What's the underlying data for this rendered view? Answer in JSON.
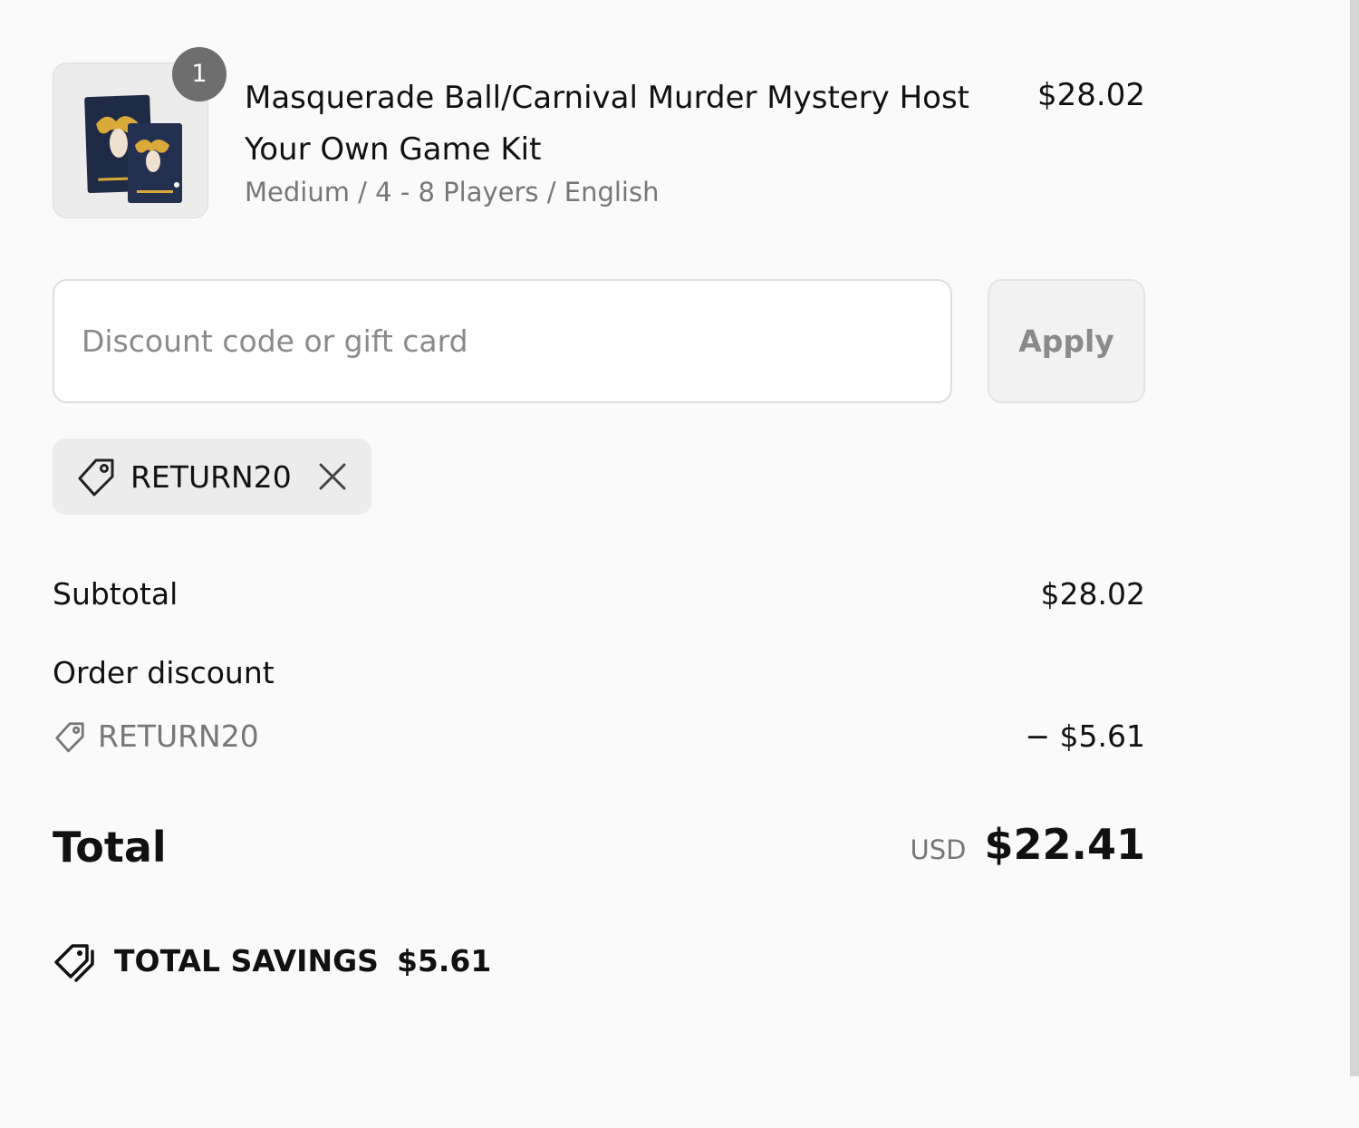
{
  "product": {
    "quantity": "1",
    "title": "Masquerade Ball/Carnival Murder Mystery Host Your Own Game Kit",
    "variant": "Medium / 4 - 8 Players / English",
    "price": "$28.02",
    "image_icon": "masquerade-mask-box-image"
  },
  "discount": {
    "placeholder": "Discount code or gift card",
    "apply_label": "Apply",
    "applied_code": "RETURN20"
  },
  "summary": {
    "subtotal_label": "Subtotal",
    "subtotal_value": "$28.02",
    "order_discount_label": "Order discount",
    "order_discount_code": "RETURN20",
    "order_discount_value": "− $5.61",
    "total_label": "Total",
    "currency": "USD",
    "total_value": "$22.41",
    "savings_label": "TOTAL SAVINGS",
    "savings_value": "$5.61"
  },
  "colors": {
    "background": "#fafafa",
    "badge": "#6e6e6e",
    "muted_text": "#777777"
  }
}
